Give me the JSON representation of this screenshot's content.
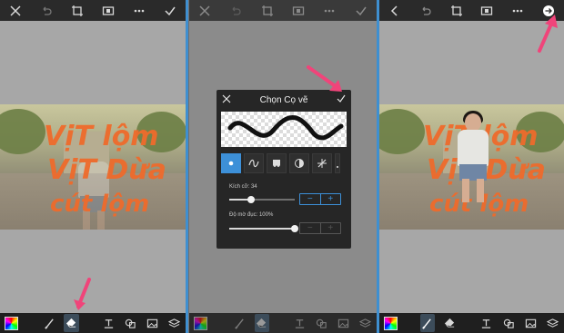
{
  "brush_dialog": {
    "title": "Chọn Cọ vẽ",
    "size_label": "Kích cỡ: 34",
    "opacity_label": "Độ mờ đục: 100%",
    "size_value_fraction": 0.34,
    "opacity_value_fraction": 1.0,
    "decrease_symbol": "−",
    "increase_symbol": "+",
    "brush_types": [
      "dot-brush",
      "wave-brush",
      "drip-brush",
      "half-circle-brush",
      "scatter-brush",
      "more-brush"
    ],
    "selected_brush": 0
  },
  "panels": [
    {
      "id": "before",
      "active_tool": "eraser",
      "drawing_lines": [
        "VịT lộm",
        "VịT Dừa",
        "cút lộm"
      ]
    },
    {
      "id": "brush-settings",
      "active_tool": "eraser"
    },
    {
      "id": "after",
      "active_tool": "brush",
      "drawing_lines": [
        "VịT lộm",
        "VịT Dừa",
        "cút lộm"
      ]
    }
  ],
  "top_toolbar_icons": [
    "close-icon",
    "undo-icon",
    "crop-icon",
    "camera-icon",
    "more-icon",
    "check-icon"
  ],
  "top_toolbar_icons_panel3": [
    "back-icon",
    "undo-icon",
    "crop-icon",
    "camera-icon",
    "more-icon",
    "next-icon"
  ],
  "bottom_toolbar_icons": [
    "color-picker-icon",
    "brush-icon",
    "eraser-icon",
    "text-icon",
    "shapes-icon",
    "image-icon",
    "layers-icon"
  ],
  "colors": {
    "accent_blue": "#3d90d8",
    "annotation_pink": "#f0447a",
    "paint_orange": "#ee6a2b",
    "toolbar_dark": "#2a2a2a"
  }
}
